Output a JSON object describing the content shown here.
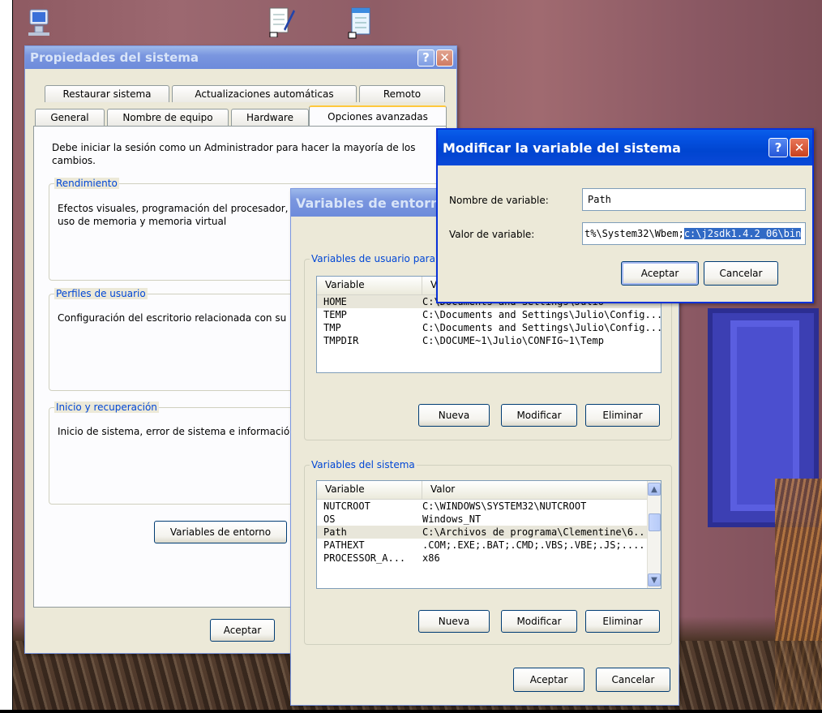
{
  "desktop": {
    "icons": [
      "computer-icon",
      "notepad-shortcut-icon",
      "notepad-shortcut-icon-2"
    ]
  },
  "sysprops": {
    "title": "Propiedades del sistema",
    "tabs_top": [
      "Restaurar sistema",
      "Actualizaciones automáticas",
      "Remoto"
    ],
    "tabs_bottom": [
      "General",
      "Nombre de equipo",
      "Hardware",
      "Opciones avanzadas"
    ],
    "admin_note": "Debe iniciar la sesión como un Administrador para hacer la mayoría de los cambios.",
    "perf_label": "Rendimiento",
    "perf_text": "Efectos visuales, programación del procesador, uso de memoria y memoria virtual",
    "profiles_label": "Perfiles de usuario",
    "profiles_text": "Configuración del escritorio relacionada con su inicio de sesión",
    "startup_label": "Inicio y recuperación",
    "startup_text": "Inicio de sistema, error de sistema e información de depuración",
    "env_button": "Variables de entorno",
    "ok_button": "Aceptar"
  },
  "envvars": {
    "title": "Variables de entorno",
    "user_group": "Variables de usuario para Julio",
    "col_variable": "Variable",
    "col_valor": "Valor",
    "user_rows": [
      {
        "name": "HOME",
        "value": "C:\\Documents and Settings\\Julio"
      },
      {
        "name": "TEMP",
        "value": "C:\\Documents and Settings\\Julio\\Config..."
      },
      {
        "name": "TMP",
        "value": "C:\\Documents and Settings\\Julio\\Config..."
      },
      {
        "name": "TMPDIR",
        "value": "C:\\DOCUME~1\\Julio\\CONFIG~1\\Temp"
      }
    ],
    "system_group": "Variables del sistema",
    "system_rows": [
      {
        "name": "NUTCROOT",
        "value": "C:\\WINDOWS\\SYSTEM32\\NUTCROOT"
      },
      {
        "name": "OS",
        "value": "Windows_NT"
      },
      {
        "name": "Path",
        "value": "C:\\Archivos de programa\\Clementine\\6...."
      },
      {
        "name": "PATHEXT",
        "value": ".COM;.EXE;.BAT;.CMD;.VBS;.VBE;.JS;...."
      },
      {
        "name": "PROCESSOR_A...",
        "value": "x86"
      }
    ],
    "new_button": "Nueva",
    "edit_button": "Modificar",
    "delete_button": "Eliminar",
    "ok_button": "Aceptar",
    "cancel_button": "Cancelar"
  },
  "editvar": {
    "title": "Modificar la variable del sistema",
    "name_label": "Nombre de variable:",
    "name_value": "Path",
    "value_label": "Valor de variable:",
    "value_unselected": "t%\\System32\\Wbem;",
    "value_selected": "c:\\j2sdk1.4.2_06\\bin",
    "ok_button": "Aceptar",
    "cancel_button": "Cancelar"
  },
  "colors": {
    "titlebar_active": "#0553e3",
    "selection": "#316ac5",
    "groupbox_label": "#0046d5"
  }
}
